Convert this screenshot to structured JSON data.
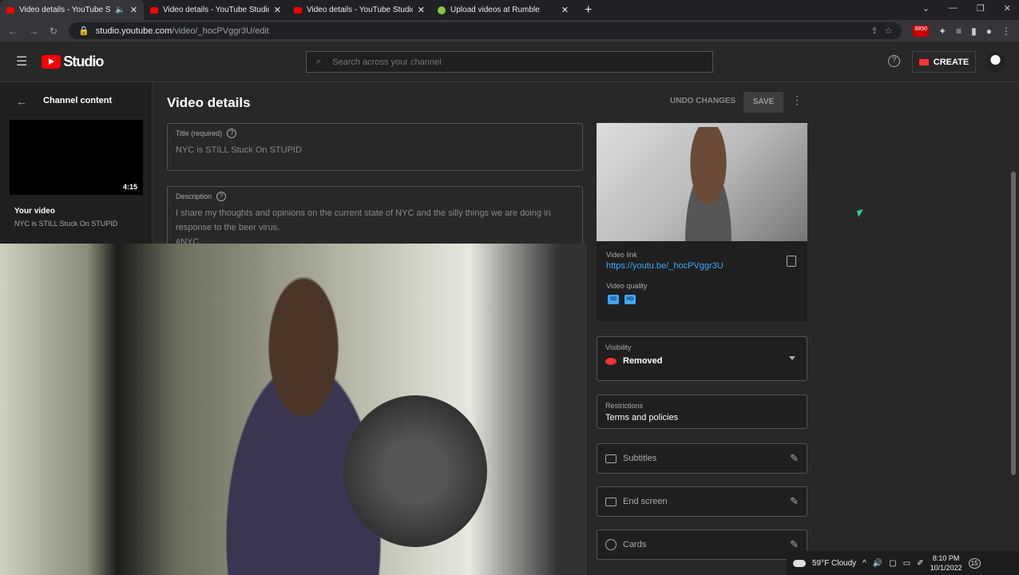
{
  "browser": {
    "tabs": [
      {
        "title": "Video details - YouTube Studio",
        "active": true,
        "audio": true
      },
      {
        "title": "Video details - YouTube Studio"
      },
      {
        "title": "Video details - YouTube Studio"
      },
      {
        "title": "Upload videos at Rumble",
        "favicon": "rumble"
      }
    ],
    "url_host": "studio.youtube.com",
    "url_path": "/video/_hocPVggr3U/edit",
    "ext_badge": "8850"
  },
  "header": {
    "logo": "Studio",
    "search_placeholder": "Search across your channel",
    "create_label": "CREATE"
  },
  "sidebar": {
    "back_label": "Channel content",
    "duration": "4:15",
    "your_video": "Your video",
    "video_title": "NYC is STILL Stuck On STUPID"
  },
  "main": {
    "title": "Video details",
    "undo": "UNDO CHANGES",
    "save": "SAVE",
    "title_field": {
      "label": "Title (required)",
      "value": "NYC is STILL Stuck On STUPID"
    },
    "description_field": {
      "label": "Description",
      "value": "I share my thoughts and opinions on the current state of NYC and the silly things we are doing in response to the beer virus.",
      "tag": "#NYC"
    }
  },
  "panel": {
    "link_label": "Video link",
    "link": "https://youtu.be/_hocPVggr3U",
    "quality_label": "Video quality",
    "qualities": [
      "SD",
      "HD"
    ],
    "visibility_label": "Visibility",
    "visibility": "Removed",
    "restrictions_label": "Restrictions",
    "restrictions": "Terms and policies",
    "subtitles": "Subtitles",
    "end_screen": "End screen",
    "cards": "Cards"
  },
  "taskbar": {
    "weather": "59°F  Cloudy",
    "time": "8:10 PM",
    "date": "10/1/2022",
    "notifications": "15"
  },
  "colors": {
    "accent": "#3ea6ff",
    "brand": "#ff0000",
    "removed": "#e33"
  }
}
